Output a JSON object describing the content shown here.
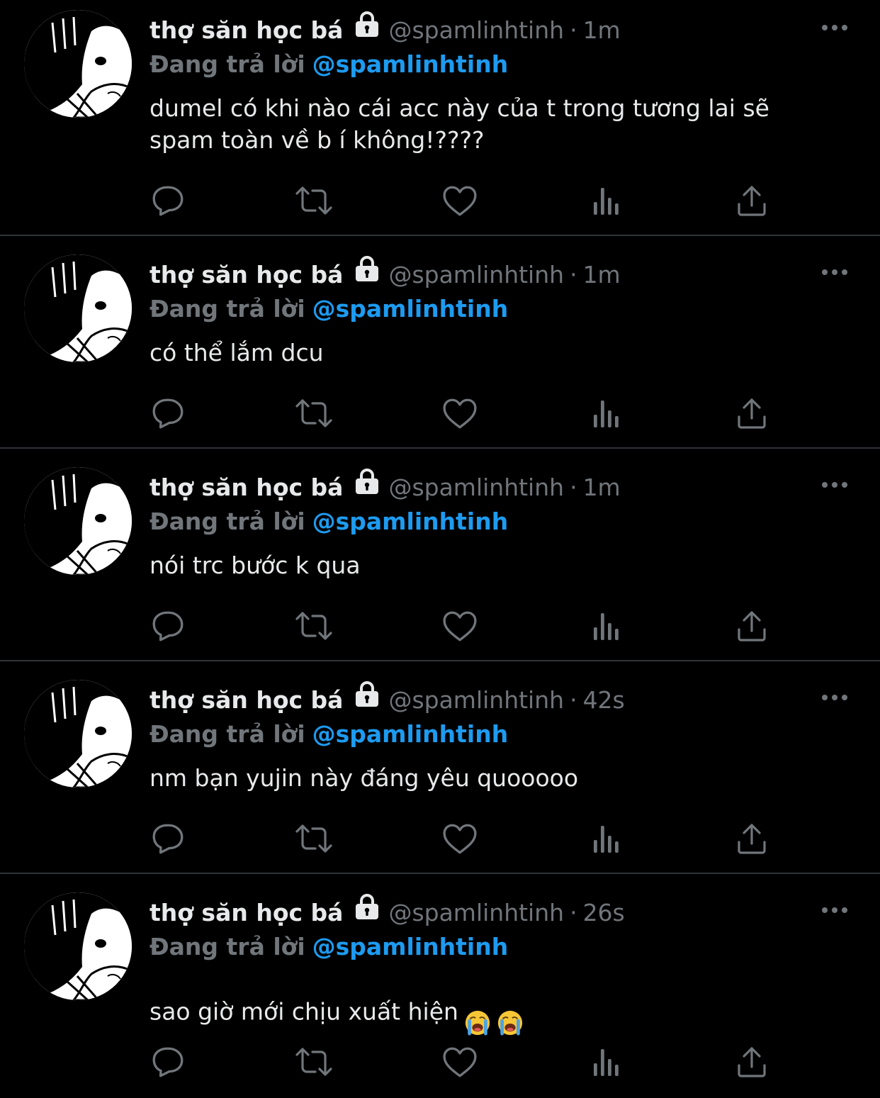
{
  "colors": {
    "background": "#000000",
    "divider": "#2f3336",
    "text_primary": "#e7e9ea",
    "text_secondary": "#71767b",
    "mention_blue": "#1d9bf0",
    "icon_gray": "#71767b"
  },
  "icons": {
    "reply": "reply-icon",
    "retweet": "retweet-icon",
    "like": "heart-icon",
    "views": "views-icon",
    "share": "share-icon",
    "more": "more-icon",
    "lock": "lock-icon"
  },
  "tweets": [
    {
      "display_name": "thợ săn học bá",
      "handle": "@spamlinhtinh",
      "separator": "·",
      "time": "1m",
      "reply_label": "Đang trả lời",
      "reply_to": "@spamlinhtinh",
      "text": "dumel có khi nào cái acc này của t trong tương lai sẽ\nspam toàn về b í không!????",
      "emoji_count": 0
    },
    {
      "display_name": "thợ săn học bá",
      "handle": "@spamlinhtinh",
      "separator": "·",
      "time": "1m",
      "reply_label": "Đang trả lời",
      "reply_to": "@spamlinhtinh",
      "text": "có thể lắm dcu",
      "emoji_count": 0
    },
    {
      "display_name": "thợ săn học bá",
      "handle": "@spamlinhtinh",
      "separator": "·",
      "time": "1m",
      "reply_label": "Đang trả lời",
      "reply_to": "@spamlinhtinh",
      "text": "nói trc bước k qua",
      "emoji_count": 0
    },
    {
      "display_name": "thợ săn học bá",
      "handle": "@spamlinhtinh",
      "separator": "·",
      "time": "42s",
      "reply_label": "Đang trả lời",
      "reply_to": "@spamlinhtinh",
      "text": "nm bạn yujin này đáng yêu quooooo",
      "emoji_count": 0
    },
    {
      "display_name": "thợ săn học bá",
      "handle": "@spamlinhtinh",
      "separator": "·",
      "time": "26s",
      "reply_label": "Đang trả lời",
      "reply_to": "@spamlinhtinh",
      "text": "sao giờ mới chịu xuất hiện",
      "emoji_count": 2,
      "emoji_name": "loudly-crying-face-emoji"
    }
  ]
}
